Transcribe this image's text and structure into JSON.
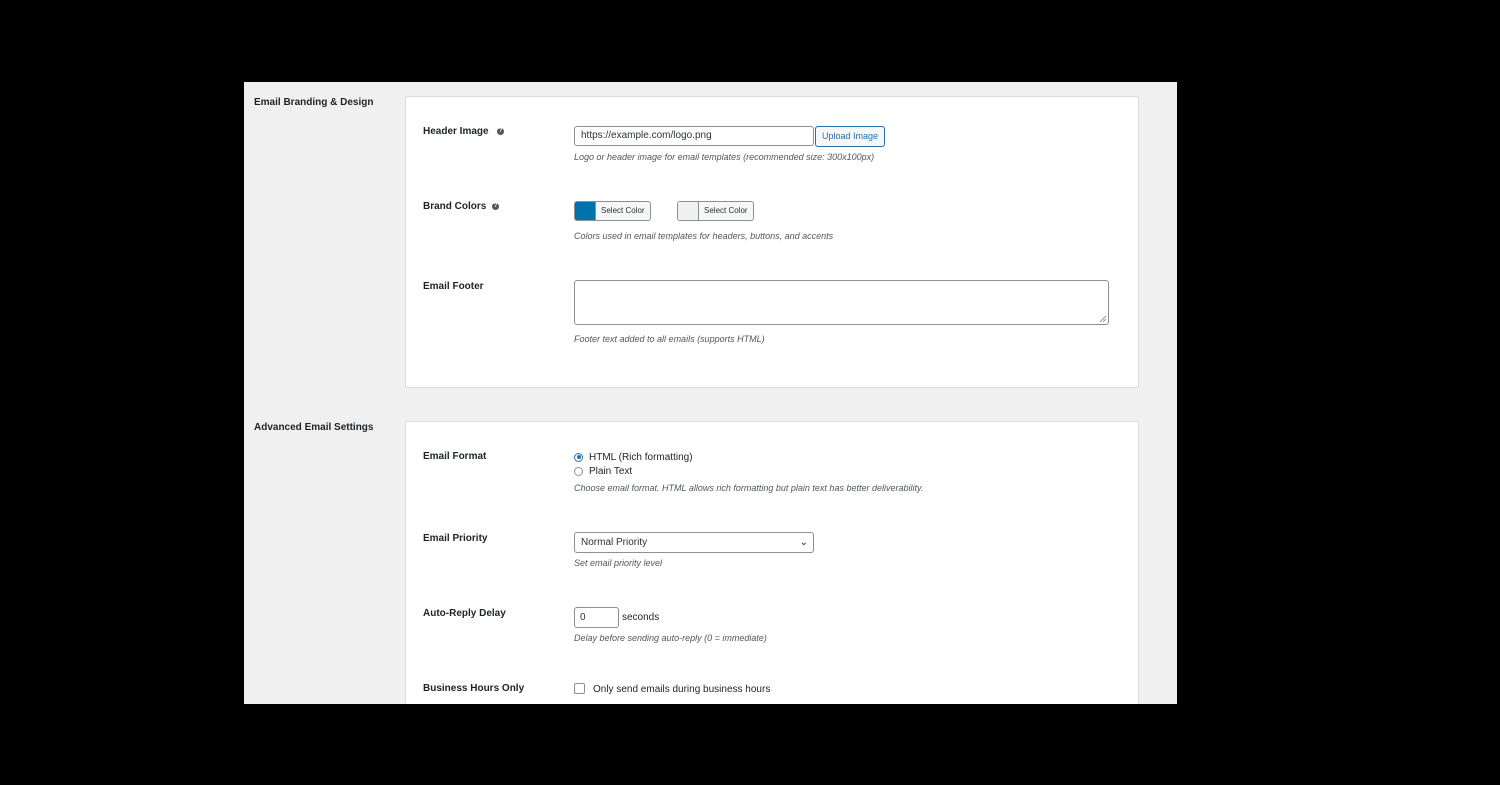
{
  "branding": {
    "section_title": "Email Branding & Design",
    "header_image": {
      "label": "Header Image",
      "help_icon": "question-circle-icon",
      "value": "https://example.com/logo.png",
      "upload_label": "Upload Image",
      "description": "Logo or header image for email templates (recommended size: 300x100px)"
    },
    "brand_colors": {
      "label": "Brand Colors",
      "help_icon": "question-circle-icon",
      "pickers": [
        {
          "label": "Select Color",
          "color": "#0073aa"
        },
        {
          "label": "Select Color",
          "color": "#f0f0f1"
        }
      ],
      "description": "Colors used in email templates for headers, buttons, and accents"
    },
    "email_footer": {
      "label": "Email Footer",
      "value": "",
      "description": "Footer text added to all emails (supports HTML)"
    }
  },
  "advanced": {
    "section_title": "Advanced Email Settings",
    "email_format": {
      "label": "Email Format",
      "options": [
        {
          "label": "HTML (Rich formatting)",
          "checked": true
        },
        {
          "label": "Plain Text",
          "checked": false
        }
      ],
      "description": "Choose email format. HTML allows rich formatting but plain text has better deliverability."
    },
    "email_priority": {
      "label": "Email Priority",
      "selected": "Normal Priority",
      "description": "Set email priority level"
    },
    "auto_reply": {
      "label": "Auto-Reply Delay",
      "value": "0",
      "unit": "seconds",
      "description": "Delay before sending auto-reply (0 = immediate)"
    },
    "business_hours": {
      "label": "Business Hours Only",
      "checkbox_label": "Only send emails during business hours",
      "checked": false
    }
  },
  "colors": {
    "accent": "#2271b1",
    "background": "#f0f0f1"
  }
}
